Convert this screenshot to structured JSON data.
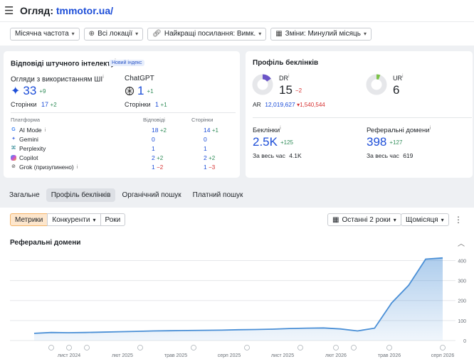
{
  "header": {
    "title_prefix": "Огляд:",
    "domain": "tmmotor.ua/"
  },
  "filters": [
    {
      "label": "Місячна частота"
    },
    {
      "label": "Всі локації"
    },
    {
      "label": "Найкращі посилання: Вимк."
    },
    {
      "label": "Зміни: Минулий місяць"
    }
  ],
  "ai": {
    "title": "Відповіді штучного інтелекту",
    "badge": "Новий індекс",
    "mentions_label": "Огляди з використанням ШІ",
    "mentions_value": "33",
    "mentions_delta": "+9",
    "pages_label": "Сторінки",
    "pages_value": "17",
    "pages_delta": "+2",
    "chatgpt_label": "ChatGPT",
    "chatgpt_value": "1",
    "chatgpt_delta": "+1",
    "chatgpt_pages_label": "Сторінки",
    "chatgpt_pages_value": "1",
    "chatgpt_pages_delta": "+1",
    "table_headers": {
      "platform": "Платформа",
      "answers": "Відповіді",
      "pages": "Сторінки"
    },
    "platforms": [
      {
        "name": "AI Mode",
        "answers": "18",
        "answers_delta": "+2",
        "pages": "14",
        "pages_delta": "+1"
      },
      {
        "name": "Gemini",
        "answers": "0",
        "answers_delta": "",
        "pages": "0",
        "pages_delta": ""
      },
      {
        "name": "Perplexity",
        "answers": "1",
        "answers_delta": "",
        "pages": "1",
        "pages_delta": ""
      },
      {
        "name": "Copilot",
        "answers": "2",
        "answers_delta": "+2",
        "pages": "2",
        "pages_delta": "+2"
      },
      {
        "name": "Grok (призупинено)",
        "answers": "1",
        "answers_delta": "−2",
        "pages": "1",
        "pages_delta": "−3"
      }
    ]
  },
  "backlinks": {
    "title": "Профіль беклінків",
    "dr_label": "DR",
    "dr_value": "15",
    "dr_delta": "−2",
    "dr_fraction": 0.15,
    "ur_label": "UR",
    "ur_value": "6",
    "ur_fraction": 0.06,
    "ar_label": "AR",
    "ar_value": "12,019,627",
    "ar_delta": "▾1,540,544",
    "backlinks_label": "Беклінки",
    "backlinks_value": "2.5K",
    "backlinks_delta": "+125",
    "backlinks_alltime_label": "За весь час",
    "backlinks_alltime": "4.1K",
    "refdomains_label": "Реферальні домени",
    "refdomains_value": "398",
    "refdomains_delta": "+127",
    "refdomains_alltime_label": "За весь час",
    "refdomains_alltime": "619"
  },
  "tabs": [
    {
      "label": "Загальне"
    },
    {
      "label": "Профіль беклінків"
    },
    {
      "label": "Органічний пошук"
    },
    {
      "label": "Платний пошук"
    }
  ],
  "chart_controls": {
    "segments": [
      "Метрики",
      "Конкуренти",
      "Роки"
    ],
    "range": "Останні 2 роки",
    "interval": "Щомісяця"
  },
  "chart_data": {
    "type": "area",
    "title": "Реферальні домени",
    "x": [
      0,
      1,
      2,
      3,
      4,
      5,
      6,
      7,
      8,
      9,
      10,
      11,
      12,
      13,
      14,
      15,
      16,
      17,
      18,
      19,
      20,
      21,
      22,
      23
    ],
    "series": [
      {
        "values": [
          36,
          40,
          39,
          40,
          42,
          44,
          46,
          48,
          49,
          50,
          51,
          52,
          54,
          55,
          57,
          60,
          62,
          63,
          58,
          48,
          62,
          188,
          276,
          407,
          413
        ]
      }
    ],
    "x_tick_labels": [
      "лист 2024",
      "лют 2025",
      "трав 2025",
      "серп 2025",
      "лист 2025",
      "лют 2026",
      "трав 2026",
      "серп 2026"
    ],
    "y_tick_labels": [
      "0",
      "100",
      "200",
      "300",
      "400"
    ],
    "ylim": [
      0,
      430
    ],
    "grid": true,
    "color": "#4a8fd6"
  }
}
